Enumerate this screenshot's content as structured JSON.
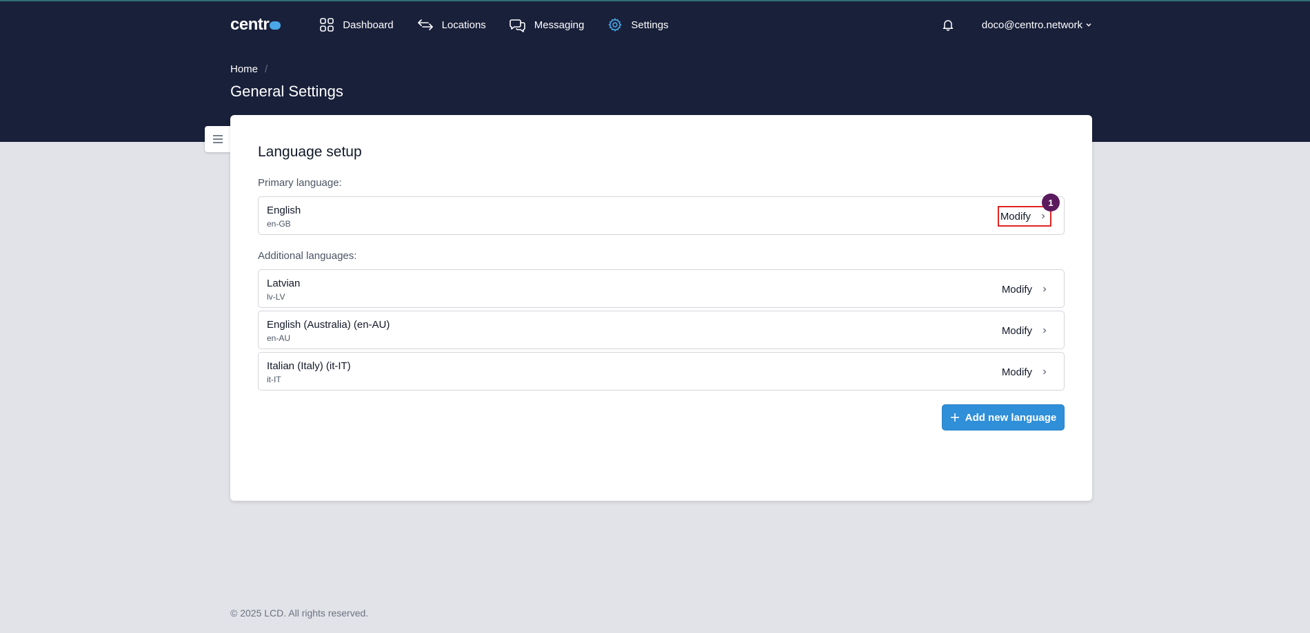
{
  "brand": {
    "name": "centr",
    "accent": "#4aa8e8"
  },
  "nav": {
    "items": [
      {
        "label": "Dashboard",
        "icon": "grid-icon"
      },
      {
        "label": "Locations",
        "icon": "arrows-exchange-icon"
      },
      {
        "label": "Messaging",
        "icon": "chat-bubbles-icon"
      },
      {
        "label": "Settings",
        "icon": "gear-icon"
      }
    ],
    "user": "doco@centro.network"
  },
  "breadcrumb": {
    "home": "Home",
    "separator": "/"
  },
  "page": {
    "title": "General Settings"
  },
  "language_setup": {
    "title": "Language setup",
    "primary_label": "Primary language:",
    "primary": {
      "name": "English",
      "code": "en-GB",
      "action": "Modify",
      "badge": "1"
    },
    "additional_label": "Additional languages:",
    "additional": [
      {
        "name": "Latvian",
        "code": "lv-LV",
        "action": "Modify"
      },
      {
        "name": "English (Australia) (en-AU)",
        "code": "en-AU",
        "action": "Modify"
      },
      {
        "name": "Italian (Italy) (it-IT)",
        "code": "it-IT",
        "action": "Modify"
      }
    ],
    "add_button": "Add new language"
  },
  "footer": {
    "text": "© 2025 LCD. All rights reserved."
  }
}
